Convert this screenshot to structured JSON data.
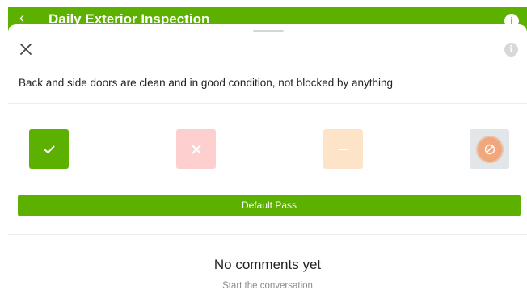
{
  "header": {
    "back_icon": "‹",
    "title": "Daily Exterior Inspection",
    "info_icon": "i",
    "background": "#5bb000"
  },
  "sheet": {
    "close_icon": "close-icon",
    "info_icon": "i",
    "question": "Back and side doors are clean and in good condition, not blocked by anything"
  },
  "options": [
    {
      "name": "pass",
      "icon": "check-icon",
      "color": "#5bb000"
    },
    {
      "name": "fail",
      "icon": "x-icon",
      "color": "#fdcfcf"
    },
    {
      "name": "not-applicable",
      "icon": "minus-icon",
      "color": "#fde3c8"
    },
    {
      "name": "skip",
      "icon": "prohibited-icon",
      "color": "#e2e6e8"
    }
  ],
  "default_pass": {
    "label": "Default Pass"
  },
  "comments": {
    "empty_title": "No comments yet",
    "empty_subtitle": "Start the conversation"
  }
}
